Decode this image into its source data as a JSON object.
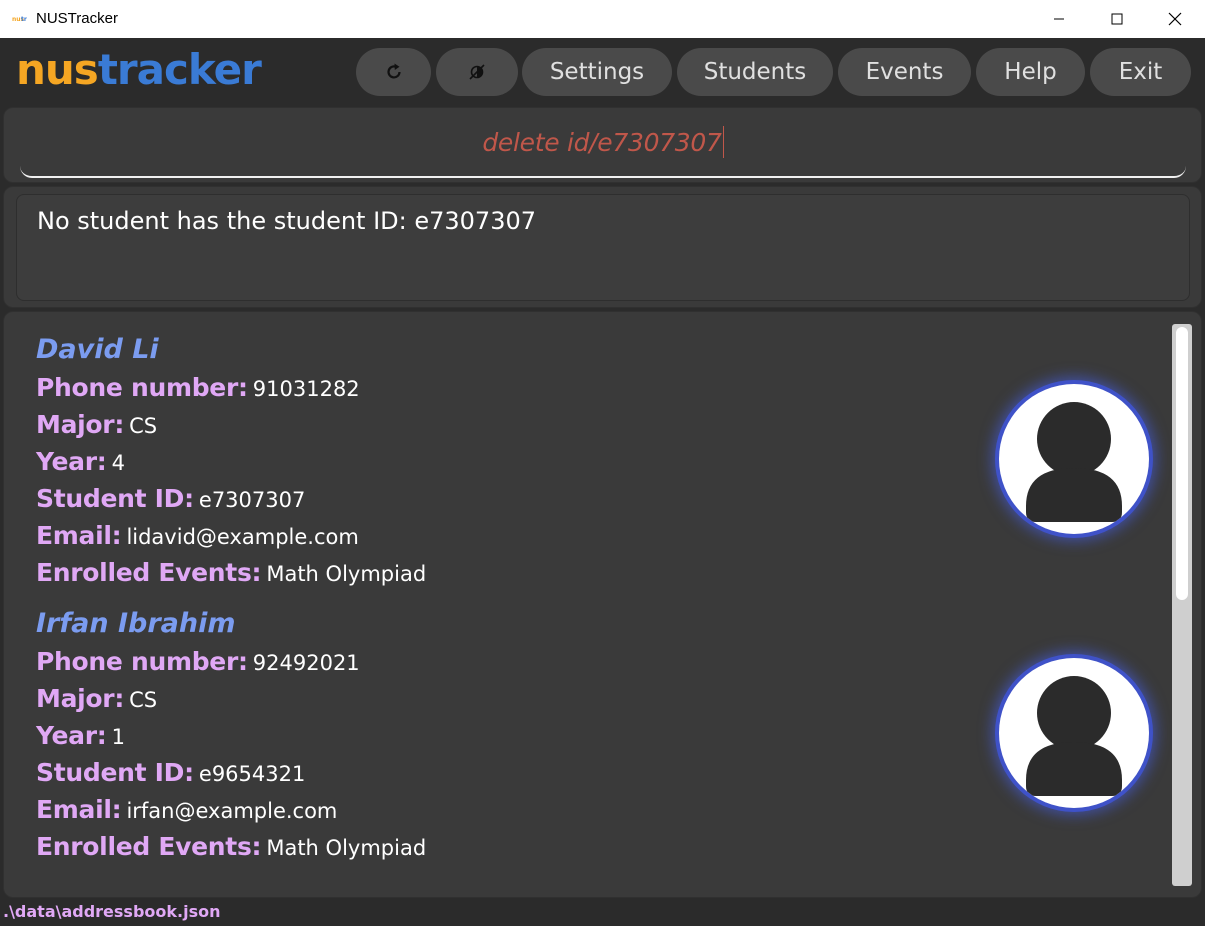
{
  "window": {
    "title": "NUSTracker",
    "icon": "nustracker-app-icon",
    "controls": [
      "minimize-icon",
      "maximize-icon",
      "close-icon"
    ]
  },
  "header": {
    "logo_part1": "nus",
    "logo_part2": "tracker",
    "buttons": {
      "refresh_icon": "refresh-icon",
      "theme_icon": "theme-toggle-icon",
      "settings": "Settings",
      "students": "Students",
      "events": "Events",
      "help": "Help",
      "exit": "Exit"
    }
  },
  "command_box": {
    "value": "delete id/e7307307"
  },
  "result_display": {
    "text": "No student has the student ID: e7307307"
  },
  "labels": {
    "phone": "Phone number:",
    "major": "Major:",
    "year": "Year:",
    "student_id": "Student ID:",
    "email": "Email:",
    "events": "Enrolled Events:"
  },
  "students": [
    {
      "name": "David Li",
      "phone": "91031282",
      "major": "CS",
      "year": "4",
      "student_id": "e7307307",
      "email": "lidavid@example.com",
      "events": "Math Olympiad"
    },
    {
      "name": "Irfan Ibrahim",
      "phone": "92492021",
      "major": "CS",
      "year": "1",
      "student_id": "e9654321",
      "email": "irfan@example.com",
      "events": "Math Olympiad"
    }
  ],
  "status_bar": {
    "path": ".\\data\\addressbook.json"
  },
  "colors": {
    "background": "#2b2b2b",
    "panel": "#3a3a3a",
    "logo_orange": "#f5a623",
    "logo_blue": "#3a7bd5",
    "name_blue": "#7b9cf0",
    "label_pink": "#e0a8f5",
    "command_text": "#c0574a"
  }
}
